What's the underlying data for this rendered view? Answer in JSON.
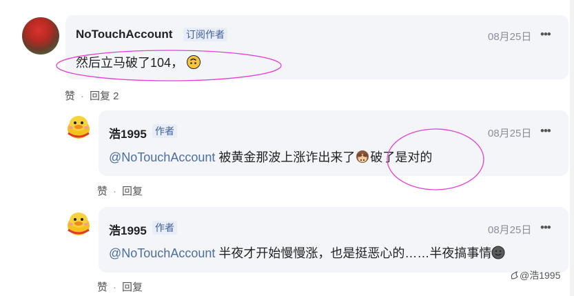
{
  "comments": [
    {
      "author": "NoTouchAccount",
      "badge": "订阅作者",
      "date": "08月25日",
      "more": "•••",
      "text": "然后立马破了104，",
      "like_label": "赞",
      "separator": "·",
      "reply_label": "回复 2",
      "emoji": "upside-down-face"
    },
    {
      "author": "浩1995",
      "badge": "作者",
      "date": "08月25日",
      "more": "•••",
      "mention": "@NoTouchAccount",
      "text_before_emoji": " 被黄金那波上涨诈出来了",
      "text_after_emoji": "破了是对的",
      "like_label": "赞",
      "separator": "·",
      "reply_label": "回复",
      "emoji": "see-no-evil-monkey"
    },
    {
      "author": "浩1995",
      "badge": "作者",
      "date": "08月25日",
      "more": "•••",
      "mention": "@NoTouchAccount",
      "text": " 半夜才开始慢慢涨，也是挺恶心的……半夜搞事情",
      "like_label": "赞",
      "separator": "·",
      "reply_label": "回复",
      "emoji": "smiling-face"
    }
  ],
  "watermark": "@浩1995",
  "colors": {
    "annotation": "#e23fd6",
    "bubble_bg": "#f4f5f8",
    "mention": "#4d6e9c",
    "badge_text": "#3f5f9f"
  }
}
